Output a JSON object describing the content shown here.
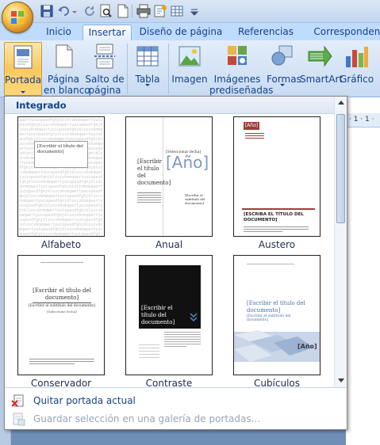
{
  "ribbon_tabs": [
    "Inicio",
    "Insertar",
    "Diseño de página",
    "Referencias",
    "Correspondencia"
  ],
  "active_tab": "Insertar",
  "ribbon": {
    "portada": {
      "line1": "Portada",
      "line2": ""
    },
    "pagina_en_blanco": {
      "line1": "Página",
      "line2": "en blanco"
    },
    "salto_de_pagina": {
      "line1": "Salto de",
      "line2": "página"
    },
    "tabla": {
      "line1": "Tabla",
      "line2": ""
    },
    "imagen": {
      "line1": "Imagen",
      "line2": ""
    },
    "imagenes_predisenadas": {
      "line1": "Imágenes",
      "line2": "prediseñadas"
    },
    "formas": {
      "line1": "Formas",
      "line2": ""
    },
    "smartart": {
      "line1": "SmartArt",
      "line2": ""
    },
    "grafico": {
      "line1": "Gráfico",
      "line2": ""
    }
  },
  "gallery": {
    "header": "Integrado",
    "items": [
      {
        "name": "Alfabeto",
        "title": "[Escribir el título del documento]"
      },
      {
        "name": "Anual",
        "title": "[Escribir el título del documento]",
        "year": "[Año]",
        "company": "[Seleccionar fecha]",
        "subtitle": "[Escribir el subtítulo del documento]"
      },
      {
        "name": "Austero",
        "year": "[Año]",
        "title": "[ESCRIBA EL TÍTULO DEL DOCUMENTO]"
      },
      {
        "name": "Conservador",
        "title": "[Escribir el título del documento]",
        "subtitle": "[Escribir el subtítulo del documento]",
        "author": "[Seleccione fecha]"
      },
      {
        "name": "Contraste",
        "title": "[Escribir el título del documento]"
      },
      {
        "name": "Cubículos",
        "title": "[Escribir el título del documento]",
        "subtitle": "[Escribir el subtítulo del documento]",
        "year": "[Año]"
      }
    ],
    "menu": {
      "remove": "Quitar portada actual",
      "save": "Guardar selección en una galería de portadas..."
    }
  },
  "ruler_marks": "· 1 · 1 ·",
  "colors": {
    "ribbon_text": "#15428b",
    "highlight": "#fbc85e",
    "austero_red": "#a43b3b",
    "thumb_blue": "#4f6fa8"
  }
}
